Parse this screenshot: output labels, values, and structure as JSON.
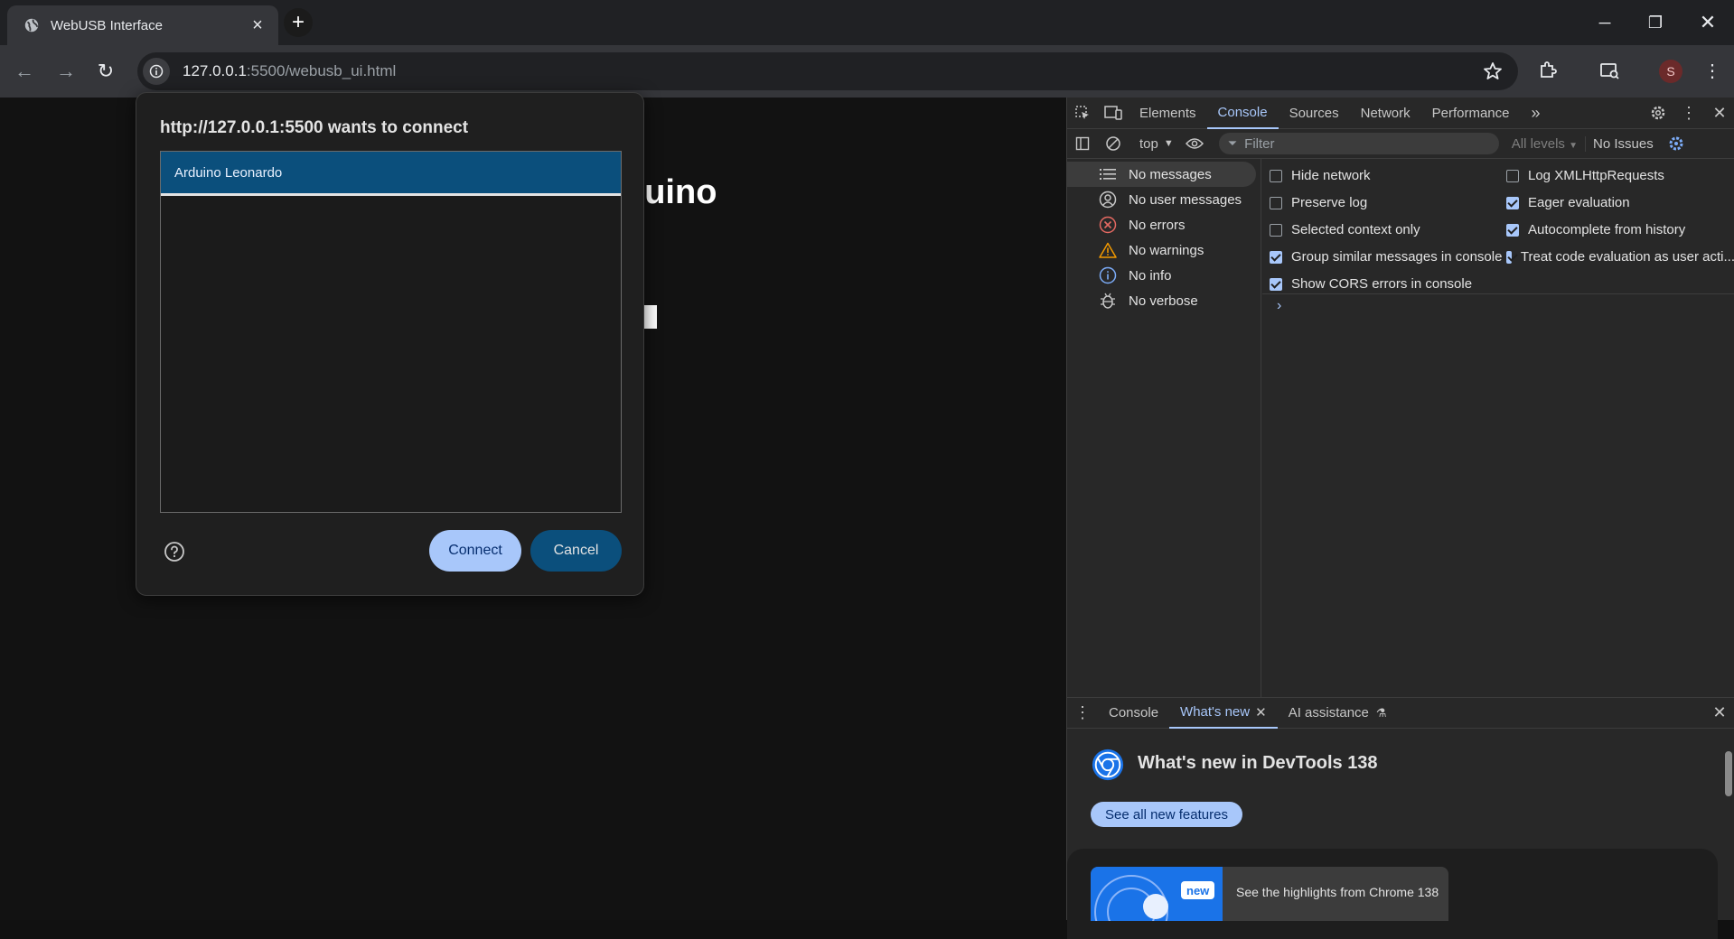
{
  "browser": {
    "tab_title": "WebUSB Interface",
    "url_host": "127.0.0.1",
    "url_rest": ":5500/webusb_ui.html",
    "avatar_letter": "S"
  },
  "page": {
    "heading_fragment": "duino",
    "button_fragment": "d"
  },
  "dialog": {
    "title": "http://127.0.0.1:5500 wants to connect",
    "devices": [
      "Arduino Leonardo"
    ],
    "connect_label": "Connect",
    "cancel_label": "Cancel"
  },
  "devtools": {
    "tabs": [
      "Elements",
      "Console",
      "Sources",
      "Network",
      "Performance"
    ],
    "active_tab": "Console",
    "context": "top",
    "filter_placeholder": "Filter",
    "levels": "All levels",
    "issues": "No Issues",
    "sidebar": [
      {
        "label": "No messages",
        "icon": "list-icon"
      },
      {
        "label": "No user messages",
        "icon": "user-icon"
      },
      {
        "label": "No errors",
        "icon": "error-icon"
      },
      {
        "label": "No warnings",
        "icon": "warning-icon"
      },
      {
        "label": "No info",
        "icon": "info-icon"
      },
      {
        "label": "No verbose",
        "icon": "bug-icon"
      }
    ],
    "settings": [
      {
        "label": "Hide network",
        "checked": false
      },
      {
        "label": "Log XMLHttpRequests",
        "checked": false
      },
      {
        "label": "Preserve log",
        "checked": false
      },
      {
        "label": "Eager evaluation",
        "checked": true
      },
      {
        "label": "Selected context only",
        "checked": false
      },
      {
        "label": "Autocomplete from history",
        "checked": true
      },
      {
        "label": "Group similar messages in console",
        "checked": true
      },
      {
        "label": "Treat code evaluation as user acti...",
        "checked": true
      },
      {
        "label": "Show CORS errors in console",
        "checked": true
      }
    ],
    "drawer": {
      "tabs": [
        "Console",
        "What's new",
        "AI assistance"
      ],
      "active_tab": "What's new",
      "whats_new_title": "What's new in DevTools 138",
      "see_all": "See all new features",
      "badge": "new",
      "highlight": "See the highlights from Chrome 138"
    }
  }
}
